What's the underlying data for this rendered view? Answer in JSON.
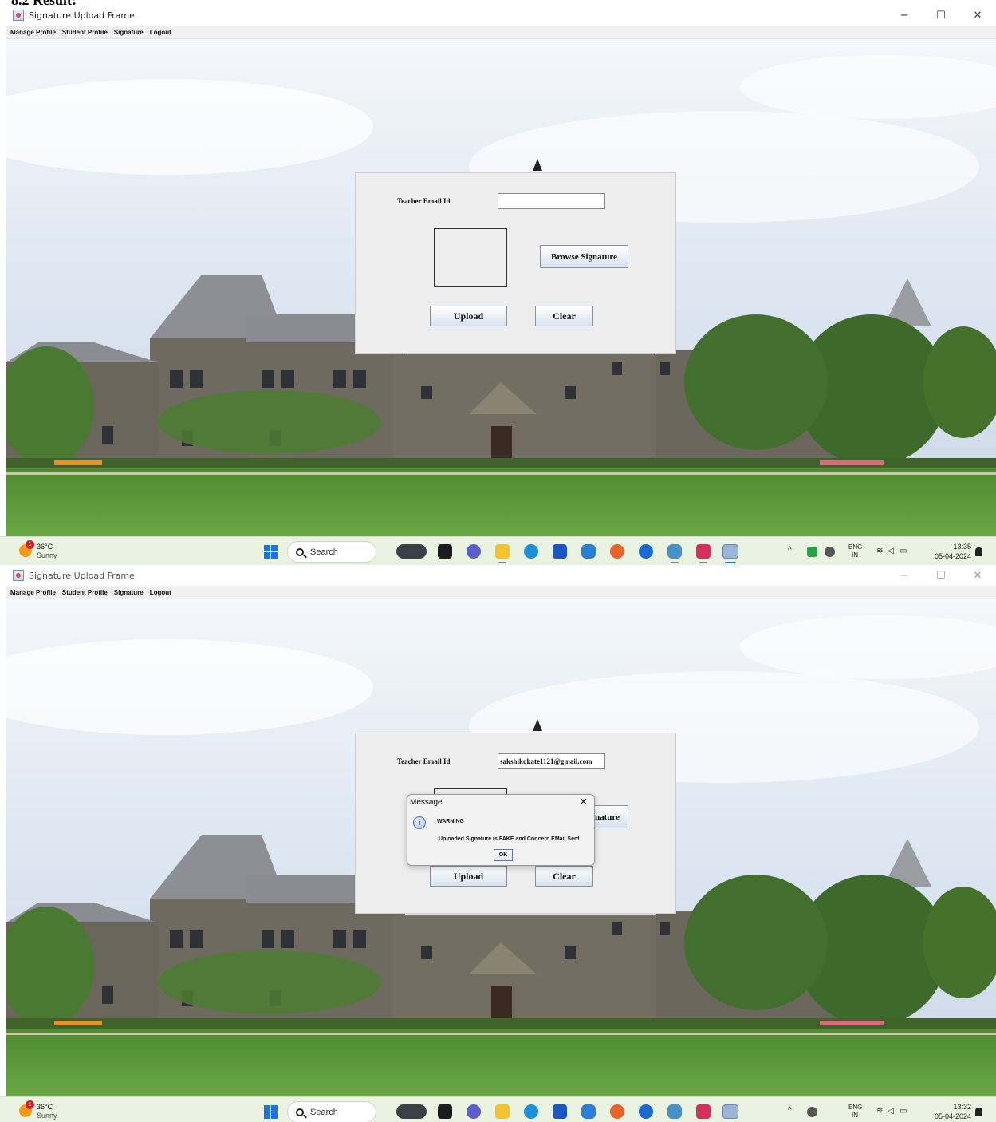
{
  "document": {
    "heading": "8.2 Result:"
  },
  "shots": [
    {
      "window": {
        "title": "Signature Upload Frame",
        "controls": [
          "−",
          "☐",
          "✕"
        ]
      },
      "menu": [
        "Manage Profile",
        "Student Profile",
        "Signature",
        "Logout"
      ],
      "form": {
        "email_label": "Teacher Email Id",
        "email_value": "",
        "browse_label": "Browse Signature",
        "upload_label": "Upload",
        "clear_label": "Clear"
      },
      "taskbar": {
        "weather_badge": "1",
        "temperature": "36°C",
        "condition": "Sunny",
        "search_label": "Search",
        "lang_top": "ENG",
        "lang_bottom": "IN",
        "time": "13:35",
        "date": "05-04-2024"
      }
    },
    {
      "window": {
        "title": "Signature Upload Frame",
        "controls": [
          "−",
          "☐",
          "✕"
        ]
      },
      "menu": [
        "Manage Profile",
        "Student Profile",
        "Signature",
        "Logout"
      ],
      "form": {
        "email_label": "Teacher Email Id",
        "email_value": "sakshikokate1121@gmail.com",
        "browse_label": "nature",
        "upload_label": "Upload",
        "clear_label": "Clear"
      },
      "dialog": {
        "title": "Message",
        "close": "✕",
        "heading": "WARNING",
        "message": "Uploaded Signature is FAKE and Concern EMail Sent",
        "ok_label": "OK"
      },
      "taskbar": {
        "weather_badge": "1",
        "temperature": "36°C",
        "condition": "Sunny",
        "search_label": "Search",
        "lang_top": "ENG",
        "lang_bottom": "IN",
        "time": "13:32",
        "date": "05-04-2024"
      }
    }
  ],
  "colors": {
    "sky": "#cfdced",
    "building_stone": "#6f6a60",
    "roof": "#8c8e94",
    "lawn": "#5f9a3c",
    "tree": "#3d6a2a",
    "taskbar": "#eaf2e2",
    "accent_blue": "#1a73e8"
  }
}
